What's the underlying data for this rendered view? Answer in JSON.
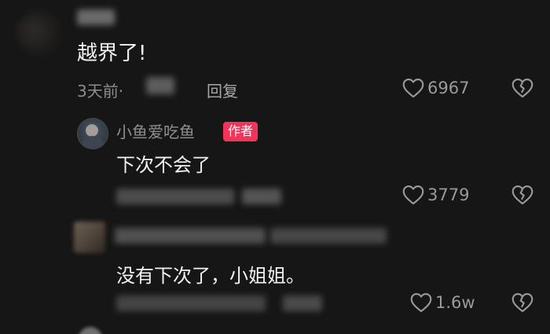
{
  "comments": [
    {
      "text": "越界了!",
      "time": "3天前·",
      "reply_label": "回复",
      "likes": "6967"
    },
    {
      "username": "小鱼爱吃鱼",
      "author_badge": "作者",
      "text": "下次不会了",
      "likes": "3779"
    },
    {
      "text": "没有下次了，小姐姐。",
      "likes": "1.6w"
    }
  ],
  "icons": {
    "like": "heart-outline-icon",
    "dislike": "broken-heart-icon"
  },
  "colors": {
    "background": "#161616",
    "author_badge": "#f0345a"
  }
}
